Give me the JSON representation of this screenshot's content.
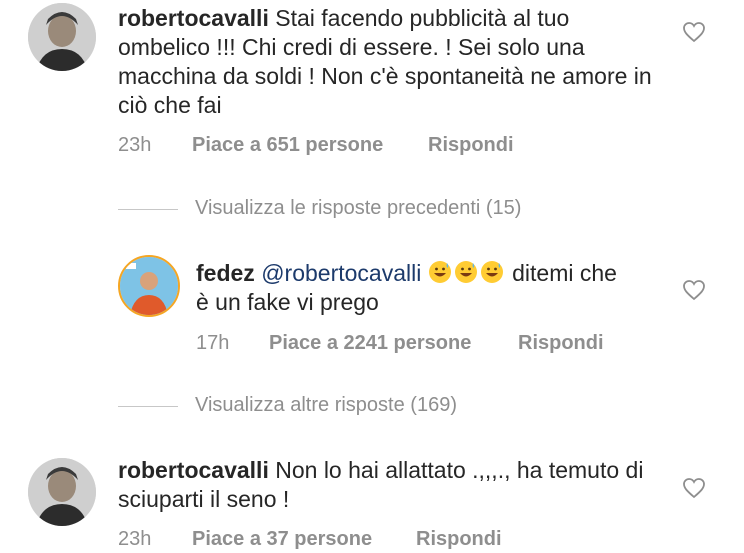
{
  "comments": [
    {
      "username": "robertocavalli",
      "text": "Stai facendo pubblicità al tuo ombelico !!! Chi credi di essere. !  Sei solo una macchina da soldi !  Non c'è spontaneità ne amore in ciò che fai",
      "time": "23h",
      "likes": "Piace a 651 persone",
      "reply": "Rispondi"
    },
    {
      "username": "fedez",
      "mention": "@robertocavalli",
      "text": "ditemi che è un fake vi prego",
      "time": "17h",
      "likes": "Piace a 2241 persone",
      "reply": "Rispondi"
    },
    {
      "username": "robertocavalli",
      "text": "Non lo hai allattato .,,,., ha temuto di sciuparti il seno !",
      "time": "23h",
      "likes": "Piace a 37 persone",
      "reply": "Rispondi"
    }
  ],
  "view_previous": "Visualizza le risposte precedenti (15)",
  "view_more": "Visualizza altre risposte (169)",
  "icons": {
    "like": "heart-outline-icon",
    "emoji": "grinning-sweat-emoji"
  },
  "colors": {
    "text": "#262626",
    "meta": "#8e8e8e",
    "mention": "#1c3a6b"
  }
}
